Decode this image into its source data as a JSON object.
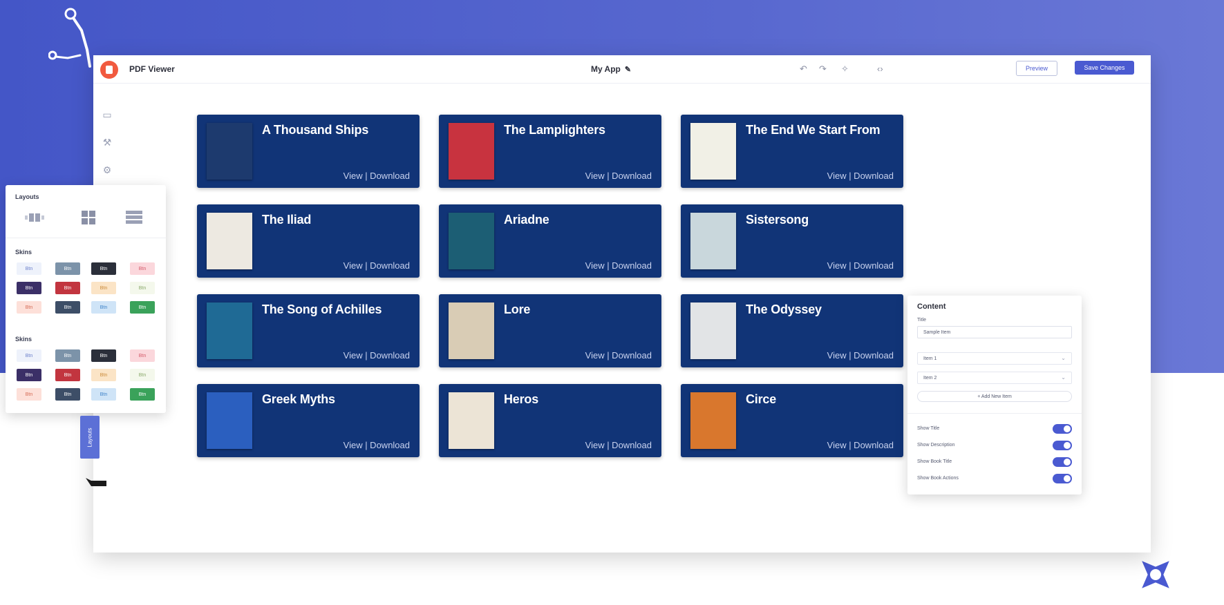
{
  "app": {
    "name": "PDF Viewer",
    "document_name": "My App",
    "preview_label": "Preview",
    "save_label": "Save Changes"
  },
  "toolbar_icons": [
    "undo-icon",
    "redo-icon",
    "magic-icon",
    "code-icon"
  ],
  "rail_icons": [
    "layout-icon",
    "wrench-icon",
    "settings-icon",
    "chart-icon"
  ],
  "books": [
    {
      "title": "A Thousand Ships",
      "actions": "View | Download",
      "cover_color": "#1d3a6e"
    },
    {
      "title": "The Lamplighters",
      "actions": "View | Download",
      "cover_color": "#c8333f"
    },
    {
      "title": "The End We Start From",
      "actions": "View | Download",
      "cover_color": "#f1f0e6"
    },
    {
      "title": "The Iliad",
      "actions": "View | Download",
      "cover_color": "#ede9e1"
    },
    {
      "title": "Ariadne",
      "actions": "View | Download",
      "cover_color": "#1c5e74"
    },
    {
      "title": "Sistersong",
      "actions": "View | Download",
      "cover_color": "#c9d7dc"
    },
    {
      "title": "The Song of Achilles",
      "actions": "View | Download",
      "cover_color": "#1f6a95"
    },
    {
      "title": "Lore",
      "actions": "View | Download",
      "cover_color": "#d9ccb5"
    },
    {
      "title": "The Odyssey",
      "actions": "View | Download",
      "cover_color": "#e2e4e6"
    },
    {
      "title": "Greek Myths",
      "actions": "View | Download",
      "cover_color": "#2b5fbf"
    },
    {
      "title": "Heros",
      "actions": "View | Download",
      "cover_color": "#ece4d6"
    },
    {
      "title": "Circe",
      "actions": "View | Download",
      "cover_color": "#d9772d"
    }
  ],
  "left_panel": {
    "layout_title": "Layouts",
    "skins_title": "Skins",
    "skins_title_2": "Skins",
    "swatch_text": "Btn",
    "swatches": [
      {
        "bg": "#eef2fb",
        "fg": "#6b7fcb"
      },
      {
        "bg": "#7c93a9",
        "fg": "#ffffff"
      },
      {
        "bg": "#2b2f3a",
        "fg": "#ffffff"
      },
      {
        "bg": "#fbd7dc",
        "fg": "#d45a6a"
      },
      {
        "bg": "#3b2f67",
        "fg": "#ffffff"
      },
      {
        "bg": "#c2353f",
        "fg": "#ffffff"
      },
      {
        "bg": "#fbe4c6",
        "fg": "#c98a3a"
      },
      {
        "bg": "#f4f8ec",
        "fg": "#8aa86a"
      },
      {
        "bg": "#fde0d9",
        "fg": "#d56a55"
      },
      {
        "bg": "#3d4e67",
        "fg": "#ffffff"
      },
      {
        "bg": "#cfe4f7",
        "fg": "#3d82c8"
      },
      {
        "bg": "#3aa25a",
        "fg": "#ffffff"
      }
    ],
    "vertical_tab_label": "Layouts"
  },
  "right_panel": {
    "title": "Content",
    "field_label": "Title",
    "field_value": "Sample Item",
    "items": [
      "Item 1",
      "Item 2"
    ],
    "add_label": "+ Add New Item",
    "toggles": [
      {
        "label": "Show Title",
        "on": true
      },
      {
        "label": "Show Description",
        "on": true
      },
      {
        "label": "Show Book Title",
        "on": true
      },
      {
        "label": "Show Book Actions",
        "on": true
      }
    ]
  }
}
